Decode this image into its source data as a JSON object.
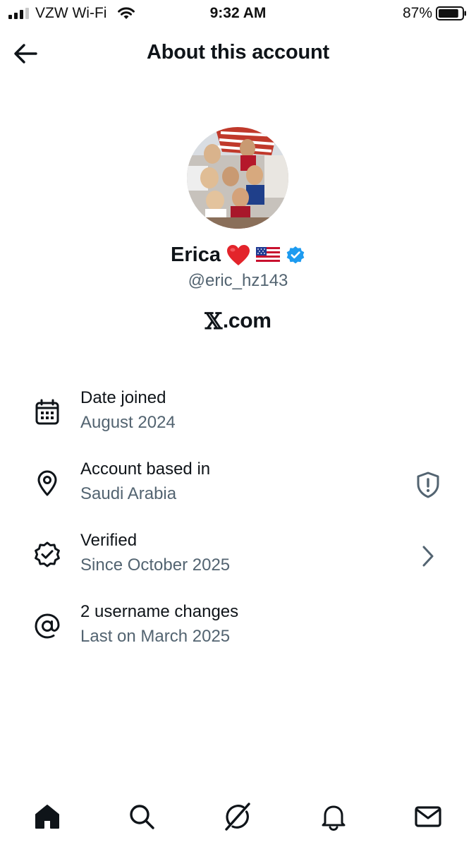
{
  "status_bar": {
    "carrier": "VZW Wi-Fi",
    "time": "9:32 AM",
    "battery_percent": "87%",
    "battery_level": 0.87,
    "icons": [
      "signal-icon",
      "wifi-icon",
      "battery-icon"
    ]
  },
  "header": {
    "title": "About this account",
    "back_icon": "arrow-left-icon"
  },
  "profile": {
    "display_name": "Erica",
    "name_emojis": [
      "❤️",
      "🇺🇸"
    ],
    "verified_badge": "verified-badge-icon",
    "handle": "@eric_hz143",
    "site": "X.com",
    "site_mark": "𝕏",
    "site_suffix": ".com"
  },
  "info": [
    {
      "icon": "calendar-icon",
      "label": "Date joined",
      "value": "August 2024"
    },
    {
      "icon": "location-pin-icon",
      "label": "Account based in",
      "value": "Saudi Arabia",
      "right_icon": "shield-alert-icon"
    },
    {
      "icon": "verified-seal-icon",
      "label": "Verified",
      "value": "Since October 2025",
      "right_icon": "chevron-right-icon"
    },
    {
      "icon": "at-sign-icon",
      "label": "2 username changes",
      "value": "Last on March 2025"
    }
  ],
  "nav": [
    {
      "name": "home",
      "icon": "home-icon"
    },
    {
      "name": "search",
      "icon": "search-icon"
    },
    {
      "name": "grok",
      "icon": "grok-icon"
    },
    {
      "name": "notifications",
      "icon": "bell-icon"
    },
    {
      "name": "messages",
      "icon": "mail-icon"
    }
  ],
  "colors": {
    "text": "#0f1419",
    "secondary": "#536471",
    "verified_blue": "#1d9bf0",
    "background": "#ffffff"
  }
}
